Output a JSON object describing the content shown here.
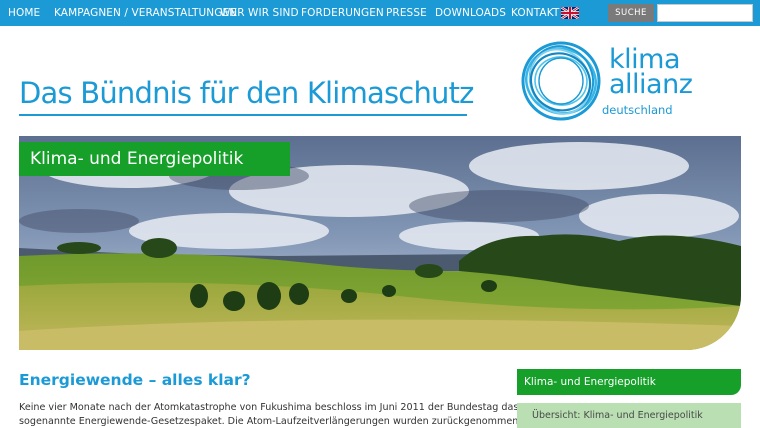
{
  "nav": {
    "items": [
      {
        "label": "HOME"
      },
      {
        "label": "KAMPAGNEN / VERANSTALTUNGEN"
      },
      {
        "label": "WER WIR SIND"
      },
      {
        "label": "FORDERUNGEN"
      },
      {
        "label": "PRESSE"
      },
      {
        "label": "DOWNLOADS"
      },
      {
        "label": "KONTAKT"
      }
    ],
    "language_icon": "uk-flag-icon",
    "search_label": "SUCHE",
    "search_value": "",
    "search_placeholder": ""
  },
  "header": {
    "title": "Das Bündnis für den Klimaschutz",
    "logo_icon": "klima-allianz-ring-logo",
    "logo_line1": "klima",
    "logo_line2": "allianz",
    "logo_line3": "deutschland"
  },
  "hero": {
    "label": "Klima- und Energiepolitik",
    "image": "landscape-meadow-with-trees-and-cloudy-sky"
  },
  "article": {
    "title": "Energiewende – alles klar?",
    "lines": [
      "Keine vier Monate nach der Atomkatastrophe von Fukushima beschloss im Juni 2011 der Bundestag das",
      "sogenannte Energiewende-Gesetzespaket. Die Atom-Laufzeitverlängerungen wurden zurückgenommen,"
    ]
  },
  "sidebar": {
    "heading": "Klima- und Energiepolitik",
    "items": [
      {
        "label": "Übersicht: Klima- und Energiepolitik"
      }
    ]
  },
  "colors": {
    "brand_blue": "#1b9ad6",
    "brand_green": "#16a02a",
    "sidebar_item_bg": "#b9dfb3",
    "search_button": "#7a7a7a"
  }
}
